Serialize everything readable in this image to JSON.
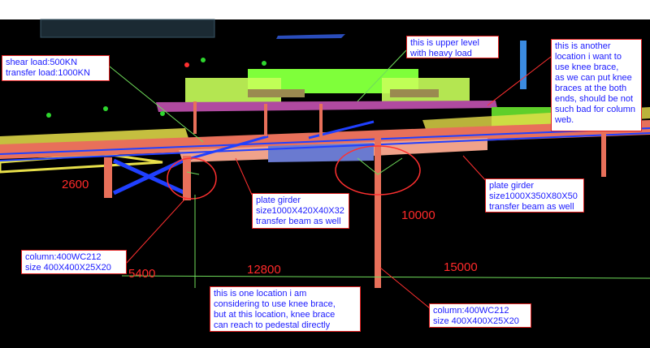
{
  "colors": {
    "background": "#000000",
    "callout_border": "#e02020",
    "callout_text": "#1a1aff",
    "dimension_text": "#ff2a2a",
    "steel": "#e8705a",
    "brace": "#2040ff",
    "platform": "#7fff3a"
  },
  "callouts": {
    "loads": "shear load:500KN\ntransfer load:1000KN",
    "upper_level": "this is upper level\nwith heavy load",
    "another_location": "this is another\nlocation i want to\nuse knee brace,\nas we can put knee\nbraces at the both\nends, should be not\nsuch bad for column\nweb.",
    "girder_left": "plate girder\nsize1000X420X40X32\ntransfer beam as well",
    "girder_right": "plate girder\nsize1000X350X80X50\ntransfer beam as well",
    "column_left": "column:400WC212\nsize 400X400X25X20",
    "column_right": "column:400WC212\nsize 400X400X25X20",
    "knee_brace_location": "this is one location i am\nconsidering to use knee brace,\nbut at this location, knee brace\ncan reach to pedestal directly"
  },
  "dimensions": {
    "d2600": "2600",
    "d10000": "10000",
    "d5400": "5400",
    "d12800": "12800",
    "d15000": "15000"
  }
}
